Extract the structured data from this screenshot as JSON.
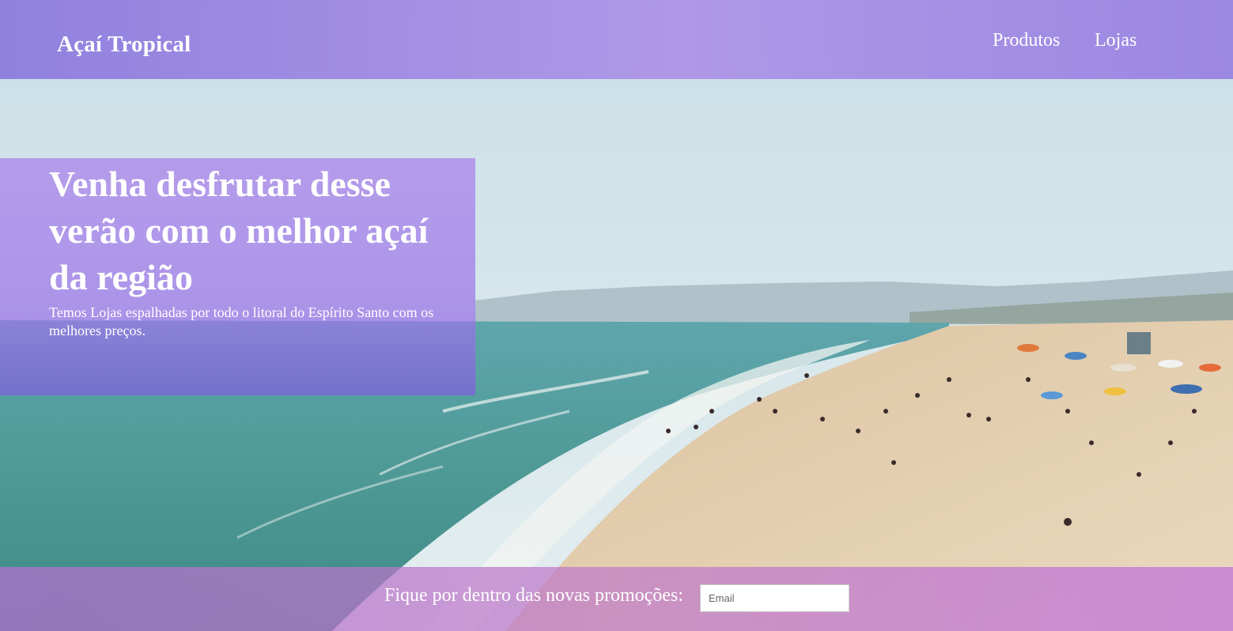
{
  "header": {
    "brand": "Açaí Tropical",
    "nav": [
      {
        "label": "Produtos"
      },
      {
        "label": "Lojas"
      }
    ]
  },
  "hero": {
    "title": "Venha desfrutar desse verão com o melhor açaí da região",
    "subtitle": "Temos Lojas espalhadas por todo o litoral do Espírito Santo com os melhores preços."
  },
  "newsletter": {
    "label": "Fique por dentro das novas promoções:",
    "email_placeholder": "Email"
  },
  "colors": {
    "header_purple": "#9b86e0",
    "panel_purple": "#b08ce6",
    "footer_purple": "#bc76cc",
    "text": "#ffffff"
  }
}
